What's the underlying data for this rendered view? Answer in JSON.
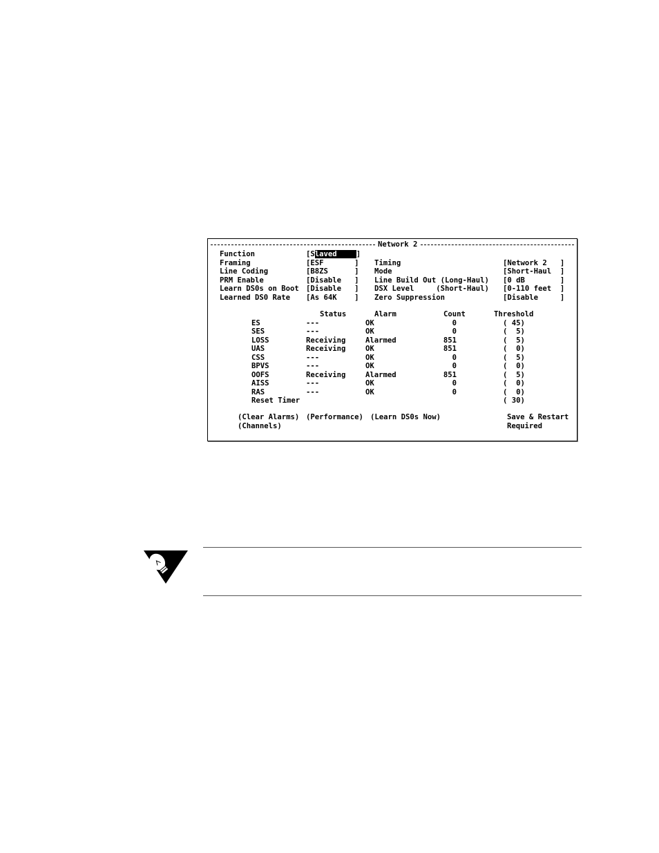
{
  "panel": {
    "title": "Network 2",
    "left_fields": [
      {
        "label": "Function",
        "open": "[",
        "cursor_char": "S",
        "value_rest": "laved",
        "close": "]"
      },
      {
        "label": "Framing",
        "value": "[ESF       ]"
      },
      {
        "label": "Line Coding",
        "value": "[B8ZS      ]"
      },
      {
        "label": "PRM Enable",
        "value": "[Disable   ]"
      },
      {
        "label": "Learn DS0s on Boot",
        "value": "[Disable   ]"
      },
      {
        "label": "Learned DS0 Rate",
        "value": "[As 64K    ]"
      }
    ],
    "right_fields": [
      {
        "label": "Timing",
        "value": "[Network 2   ]"
      },
      {
        "label": "Mode",
        "value": "[Short-Haul  ]"
      },
      {
        "label": "Line Build Out (Long-Haul)",
        "value": "[0 dB        ]"
      },
      {
        "label": "DSX Level     (Short-Haul)",
        "value": "[0-110 feet  ]"
      },
      {
        "label": "Zero Suppression",
        "value": "[Disable     ]"
      }
    ],
    "table": {
      "headers": [
        "Status",
        "Alarm",
        "Count",
        "Threshold"
      ],
      "rows": [
        {
          "name": "ES",
          "status": "---",
          "alarm": "OK",
          "count": "0",
          "threshold": "( 45)"
        },
        {
          "name": "SES",
          "status": "---",
          "alarm": "OK",
          "count": "0",
          "threshold": "(  5)"
        },
        {
          "name": "LOSS",
          "status": "Receiving",
          "alarm": "Alarmed",
          "count": "851",
          "threshold": "(  5)"
        },
        {
          "name": "UAS",
          "status": "Receiving",
          "alarm": "OK",
          "count": "851",
          "threshold": "(  0)"
        },
        {
          "name": "CSS",
          "status": "---",
          "alarm": "OK",
          "count": "0",
          "threshold": "(  5)"
        },
        {
          "name": "BPVS",
          "status": "---",
          "alarm": "OK",
          "count": "0",
          "threshold": "(  0)"
        },
        {
          "name": "OOFS",
          "status": "Receiving",
          "alarm": "Alarmed",
          "count": "851",
          "threshold": "(  5)"
        },
        {
          "name": "AISS",
          "status": "---",
          "alarm": "OK",
          "count": "0",
          "threshold": "(  0)"
        },
        {
          "name": "RAS",
          "status": "---",
          "alarm": "OK",
          "count": "0",
          "threshold": "(  0)"
        }
      ],
      "reset_timer": {
        "label": "Reset Timer",
        "threshold": "( 30)"
      }
    },
    "actions": {
      "clear_alarms": "(Clear Alarms)",
      "performance": "(Performance)",
      "learn_ds0s": "(Learn DS0s Now)",
      "channels": "(Channels)"
    },
    "status_note": {
      "line1": "Save & Restart",
      "line2": "Required"
    }
  },
  "note_icon": "lightbulb-tip-icon"
}
